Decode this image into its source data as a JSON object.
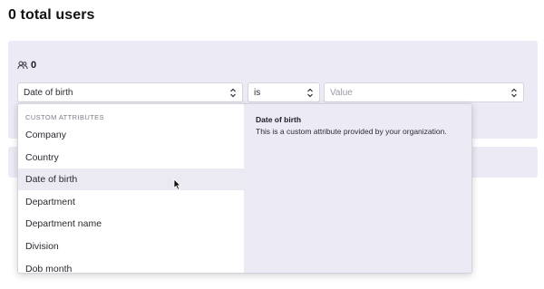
{
  "header": {
    "title": "0 total users"
  },
  "filter": {
    "user_count": "0",
    "attribute_select": {
      "value": "Date of birth"
    },
    "operator_select": {
      "value": "is"
    },
    "value_input": {
      "placeholder": "Value"
    }
  },
  "dropdown": {
    "group_label": "CUSTOM ATTRIBUTES",
    "items": [
      {
        "label": "Company"
      },
      {
        "label": "Country"
      },
      {
        "label": "Date of birth"
      },
      {
        "label": "Department"
      },
      {
        "label": "Department name"
      },
      {
        "label": "Division"
      },
      {
        "label": "Dob month"
      }
    ],
    "active_item": "Date of birth",
    "detail": {
      "title": "Date of birth",
      "description": "This is a custom attribute provided by your organization."
    }
  },
  "icons": {
    "users": "users-icon",
    "chevron": "chevron-up-down-icon",
    "cursor": "mouse-pointer-icon"
  }
}
